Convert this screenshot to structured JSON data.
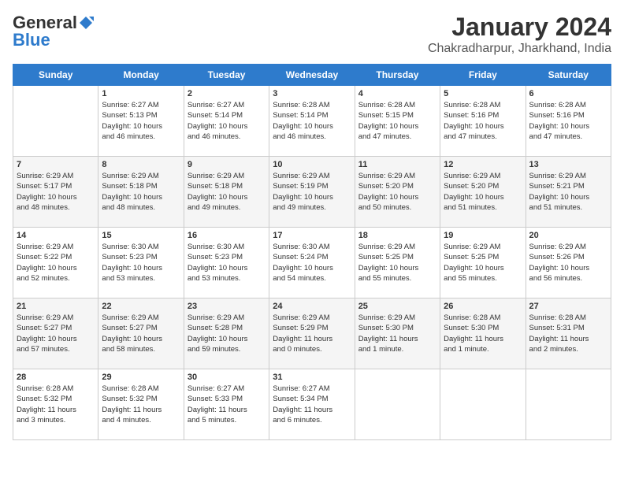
{
  "logo": {
    "general": "General",
    "blue": "Blue"
  },
  "title": {
    "month": "January 2024",
    "location": "Chakradharpur, Jharkhand, India"
  },
  "headers": [
    "Sunday",
    "Monday",
    "Tuesday",
    "Wednesday",
    "Thursday",
    "Friday",
    "Saturday"
  ],
  "weeks": [
    [
      {
        "day": "",
        "details": ""
      },
      {
        "day": "1",
        "details": "Sunrise: 6:27 AM\nSunset: 5:13 PM\nDaylight: 10 hours\nand 46 minutes."
      },
      {
        "day": "2",
        "details": "Sunrise: 6:27 AM\nSunset: 5:14 PM\nDaylight: 10 hours\nand 46 minutes."
      },
      {
        "day": "3",
        "details": "Sunrise: 6:28 AM\nSunset: 5:14 PM\nDaylight: 10 hours\nand 46 minutes."
      },
      {
        "day": "4",
        "details": "Sunrise: 6:28 AM\nSunset: 5:15 PM\nDaylight: 10 hours\nand 47 minutes."
      },
      {
        "day": "5",
        "details": "Sunrise: 6:28 AM\nSunset: 5:16 PM\nDaylight: 10 hours\nand 47 minutes."
      },
      {
        "day": "6",
        "details": "Sunrise: 6:28 AM\nSunset: 5:16 PM\nDaylight: 10 hours\nand 47 minutes."
      }
    ],
    [
      {
        "day": "7",
        "details": "Sunrise: 6:29 AM\nSunset: 5:17 PM\nDaylight: 10 hours\nand 48 minutes."
      },
      {
        "day": "8",
        "details": "Sunrise: 6:29 AM\nSunset: 5:18 PM\nDaylight: 10 hours\nand 48 minutes."
      },
      {
        "day": "9",
        "details": "Sunrise: 6:29 AM\nSunset: 5:18 PM\nDaylight: 10 hours\nand 49 minutes."
      },
      {
        "day": "10",
        "details": "Sunrise: 6:29 AM\nSunset: 5:19 PM\nDaylight: 10 hours\nand 49 minutes."
      },
      {
        "day": "11",
        "details": "Sunrise: 6:29 AM\nSunset: 5:20 PM\nDaylight: 10 hours\nand 50 minutes."
      },
      {
        "day": "12",
        "details": "Sunrise: 6:29 AM\nSunset: 5:20 PM\nDaylight: 10 hours\nand 51 minutes."
      },
      {
        "day": "13",
        "details": "Sunrise: 6:29 AM\nSunset: 5:21 PM\nDaylight: 10 hours\nand 51 minutes."
      }
    ],
    [
      {
        "day": "14",
        "details": "Sunrise: 6:29 AM\nSunset: 5:22 PM\nDaylight: 10 hours\nand 52 minutes."
      },
      {
        "day": "15",
        "details": "Sunrise: 6:30 AM\nSunset: 5:23 PM\nDaylight: 10 hours\nand 53 minutes."
      },
      {
        "day": "16",
        "details": "Sunrise: 6:30 AM\nSunset: 5:23 PM\nDaylight: 10 hours\nand 53 minutes."
      },
      {
        "day": "17",
        "details": "Sunrise: 6:30 AM\nSunset: 5:24 PM\nDaylight: 10 hours\nand 54 minutes."
      },
      {
        "day": "18",
        "details": "Sunrise: 6:29 AM\nSunset: 5:25 PM\nDaylight: 10 hours\nand 55 minutes."
      },
      {
        "day": "19",
        "details": "Sunrise: 6:29 AM\nSunset: 5:25 PM\nDaylight: 10 hours\nand 55 minutes."
      },
      {
        "day": "20",
        "details": "Sunrise: 6:29 AM\nSunset: 5:26 PM\nDaylight: 10 hours\nand 56 minutes."
      }
    ],
    [
      {
        "day": "21",
        "details": "Sunrise: 6:29 AM\nSunset: 5:27 PM\nDaylight: 10 hours\nand 57 minutes."
      },
      {
        "day": "22",
        "details": "Sunrise: 6:29 AM\nSunset: 5:27 PM\nDaylight: 10 hours\nand 58 minutes."
      },
      {
        "day": "23",
        "details": "Sunrise: 6:29 AM\nSunset: 5:28 PM\nDaylight: 10 hours\nand 59 minutes."
      },
      {
        "day": "24",
        "details": "Sunrise: 6:29 AM\nSunset: 5:29 PM\nDaylight: 11 hours\nand 0 minutes."
      },
      {
        "day": "25",
        "details": "Sunrise: 6:29 AM\nSunset: 5:30 PM\nDaylight: 11 hours\nand 1 minute."
      },
      {
        "day": "26",
        "details": "Sunrise: 6:28 AM\nSunset: 5:30 PM\nDaylight: 11 hours\nand 1 minute."
      },
      {
        "day": "27",
        "details": "Sunrise: 6:28 AM\nSunset: 5:31 PM\nDaylight: 11 hours\nand 2 minutes."
      }
    ],
    [
      {
        "day": "28",
        "details": "Sunrise: 6:28 AM\nSunset: 5:32 PM\nDaylight: 11 hours\nand 3 minutes."
      },
      {
        "day": "29",
        "details": "Sunrise: 6:28 AM\nSunset: 5:32 PM\nDaylight: 11 hours\nand 4 minutes."
      },
      {
        "day": "30",
        "details": "Sunrise: 6:27 AM\nSunset: 5:33 PM\nDaylight: 11 hours\nand 5 minutes."
      },
      {
        "day": "31",
        "details": "Sunrise: 6:27 AM\nSunset: 5:34 PM\nDaylight: 11 hours\nand 6 minutes."
      },
      {
        "day": "",
        "details": ""
      },
      {
        "day": "",
        "details": ""
      },
      {
        "day": "",
        "details": ""
      }
    ]
  ]
}
